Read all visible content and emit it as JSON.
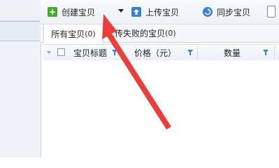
{
  "toolbar": {
    "create_label": "创建宝贝",
    "upload_label": "上传宝贝",
    "sync_label": "同步宝贝"
  },
  "tabs": [
    {
      "label": "所有宝贝",
      "count": "(0)"
    },
    {
      "label": "上传失败的宝贝",
      "count": "(0)"
    }
  ],
  "table": {
    "columns": [
      "宝贝标题",
      "价格（元）",
      "数量"
    ]
  },
  "colors": {
    "arrow": "#e8403c",
    "accent_blue": "#3b7fd0",
    "accent_green": "#4aa935"
  }
}
